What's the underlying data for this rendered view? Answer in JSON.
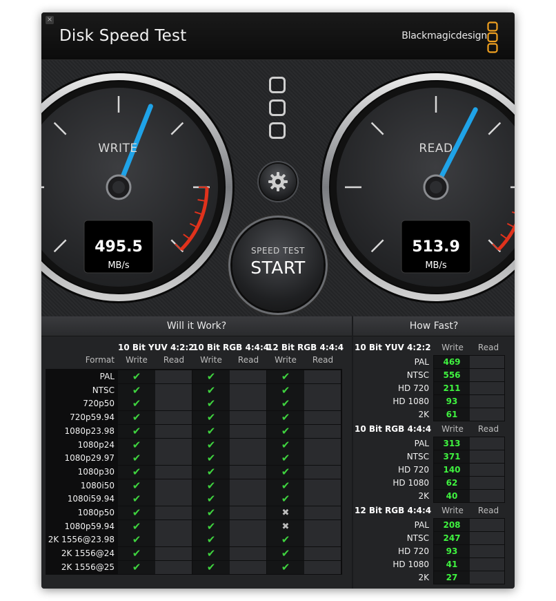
{
  "window": {
    "title": "Disk Speed Test",
    "brand": "Blackmagicdesign",
    "close_glyph": "×"
  },
  "gauges": {
    "write": {
      "label": "WRITE",
      "value": "495.5",
      "unit": "MB/s",
      "needle_fraction": 0.58
    },
    "read": {
      "label": "READ",
      "value": "513.9",
      "unit": "MB/s",
      "needle_fraction": 0.6
    }
  },
  "controls": {
    "start_line1": "SPEED TEST",
    "start_line2": "START",
    "settings_icon": "gear-icon"
  },
  "will_it_work": {
    "heading": "Will it Work?",
    "format_label": "Format",
    "groups": [
      "10 Bit YUV 4:2:2",
      "10 Bit RGB 4:4:4",
      "12 Bit RGB 4:4:4"
    ],
    "write_label": "Write",
    "read_label": "Read",
    "check_glyph": "✔",
    "cross_glyph": "✖",
    "rows": [
      {
        "format": "PAL",
        "write": [
          "ok",
          "ok",
          "ok"
        ]
      },
      {
        "format": "NTSC",
        "write": [
          "ok",
          "ok",
          "ok"
        ]
      },
      {
        "format": "720p50",
        "write": [
          "ok",
          "ok",
          "ok"
        ]
      },
      {
        "format": "720p59.94",
        "write": [
          "ok",
          "ok",
          "ok"
        ]
      },
      {
        "format": "1080p23.98",
        "write": [
          "ok",
          "ok",
          "ok"
        ]
      },
      {
        "format": "1080p24",
        "write": [
          "ok",
          "ok",
          "ok"
        ]
      },
      {
        "format": "1080p29.97",
        "write": [
          "ok",
          "ok",
          "ok"
        ]
      },
      {
        "format": "1080p30",
        "write": [
          "ok",
          "ok",
          "ok"
        ]
      },
      {
        "format": "1080i50",
        "write": [
          "ok",
          "ok",
          "ok"
        ]
      },
      {
        "format": "1080i59.94",
        "write": [
          "ok",
          "ok",
          "ok"
        ]
      },
      {
        "format": "1080p50",
        "write": [
          "ok",
          "ok",
          "no"
        ]
      },
      {
        "format": "1080p59.94",
        "write": [
          "ok",
          "ok",
          "no"
        ]
      },
      {
        "format": "2K 1556@23.98",
        "write": [
          "ok",
          "ok",
          "ok"
        ]
      },
      {
        "format": "2K 1556@24",
        "write": [
          "ok",
          "ok",
          "ok"
        ]
      },
      {
        "format": "2K 1556@25",
        "write": [
          "ok",
          "ok",
          "ok"
        ]
      }
    ]
  },
  "how_fast": {
    "heading": "How Fast?",
    "write_label": "Write",
    "read_label": "Read",
    "sections": [
      {
        "title": "10 Bit YUV 4:2:2",
        "rows": [
          {
            "format": "PAL",
            "write": "469"
          },
          {
            "format": "NTSC",
            "write": "556"
          },
          {
            "format": "HD 720",
            "write": "211"
          },
          {
            "format": "HD 1080",
            "write": "93"
          },
          {
            "format": "2K",
            "write": "61"
          }
        ]
      },
      {
        "title": "10 Bit RGB 4:4:4",
        "rows": [
          {
            "format": "PAL",
            "write": "313"
          },
          {
            "format": "NTSC",
            "write": "371"
          },
          {
            "format": "HD 720",
            "write": "140"
          },
          {
            "format": "HD 1080",
            "write": "62"
          },
          {
            "format": "2K",
            "write": "40"
          }
        ]
      },
      {
        "title": "12 Bit RGB 4:4:4",
        "rows": [
          {
            "format": "PAL",
            "write": "208"
          },
          {
            "format": "NTSC",
            "write": "247"
          },
          {
            "format": "HD 720",
            "write": "93"
          },
          {
            "format": "HD 1080",
            "write": "41"
          },
          {
            "format": "2K",
            "write": "27"
          }
        ]
      }
    ]
  },
  "colors": {
    "accent_needle": "#1fa3e8",
    "ok_green": "#3fd23f",
    "value_green": "#3ff23f",
    "redline": "#e0321c",
    "brand_orange": "#f0a020"
  }
}
